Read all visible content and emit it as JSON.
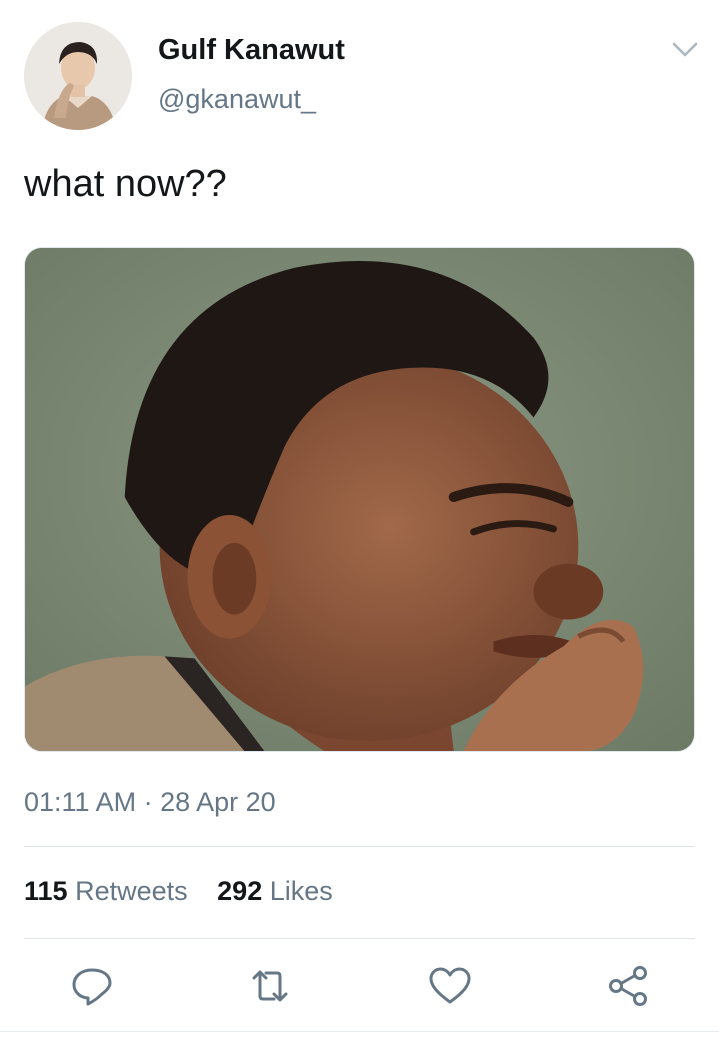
{
  "author": {
    "display_name": "Gulf Kanawut",
    "handle": "@gkanawut_",
    "avatar_icon": "profile-photo"
  },
  "tweet": {
    "text": "what now??",
    "media_description_icon": "attached-photo",
    "timestamp": "01:11 AM · 28 Apr 20"
  },
  "stats": {
    "retweets_count": "115",
    "retweets_label": "Retweets",
    "likes_count": "292",
    "likes_label": "Likes"
  },
  "actions": {
    "reply_icon": "reply-icon",
    "retweet_icon": "retweet-icon",
    "like_icon": "heart-icon",
    "share_icon": "share-icon"
  },
  "colors": {
    "text_primary": "#14171a",
    "text_secondary": "#657786",
    "icon": "#657786",
    "divider": "#dfe4e8"
  }
}
